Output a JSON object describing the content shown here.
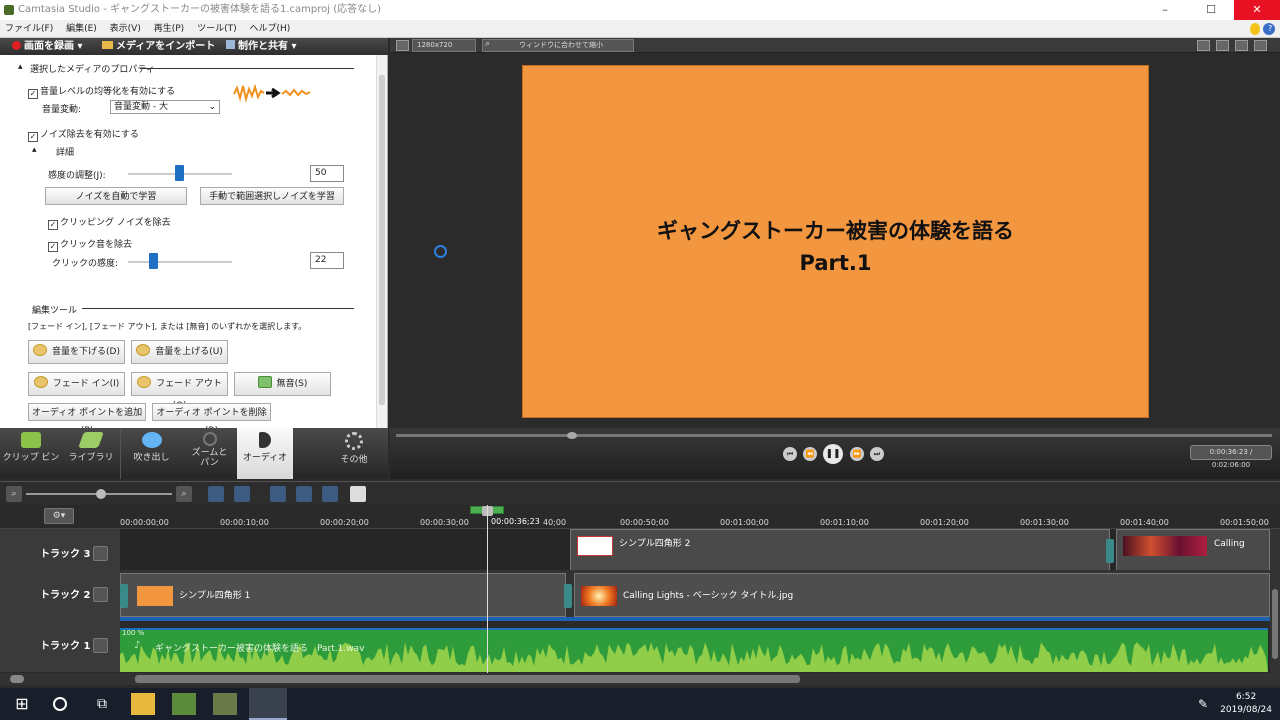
{
  "window": {
    "title": "Camtasia Studio - ギャングストーカーの被害体験を語る1.camproj (応答なし)",
    "min": "–",
    "max": "☐",
    "close": "✕"
  },
  "menu": [
    "ファイル(F)",
    "編集(E)",
    "表示(V)",
    "再生(P)",
    "ツール(T)",
    "ヘルプ(H)"
  ],
  "toolbar": {
    "record": "画面を録画 ▾",
    "import": "メディアをインポート",
    "produce": "制作と共有 ▾"
  },
  "props": {
    "section_title": "選択したメディアのプロパティ",
    "volume_leveling": "音量レベルの均等化を有効にする",
    "volume_change_label": "音量変動:",
    "volume_change_value": "音量変動 - 大",
    "noise_removal": "ノイズ除去を有効にする",
    "details": "詳細",
    "sensitivity_label": "感度の調整(J):",
    "sensitivity_value": "50",
    "auto_learn": "ノイズを自動で学習",
    "manual_learn": "手動で範囲選択しノイズを学習",
    "remove_clipping": "クリッピング ノイズを除去",
    "remove_clicks": "クリック音を除去",
    "click_sensitivity_label": "クリックの感度:",
    "click_sensitivity_value": "22",
    "edit_tools": "編集ツール",
    "edit_desc": "[フェード イン], [フェード アウト], または [無音] のいずれかを選択します。",
    "vol_down": "音量を下げる(D)",
    "vol_up": "音量を上げる(U)",
    "fade_in": "フェード イン(I)",
    "fade_out": "フェード アウト(O)",
    "silence": "無音(S)",
    "add_point": "オーディオ ポイントを追加(P)",
    "del_point": "オーディオ ポイントを削除(R)"
  },
  "tabs": [
    {
      "label": "クリップ ビン"
    },
    {
      "label": "ライブラリ"
    },
    {
      "label": "吹き出し"
    },
    {
      "label": "ズームと\nパン"
    },
    {
      "label": "オーディオ"
    },
    {
      "label": "その他"
    }
  ],
  "preview": {
    "size_box": "1280x720",
    "fit_box": "ウィンドウに合わせて縮小",
    "canvas_line1": "ギャングストーカー被害の体験を語る",
    "canvas_line2": "Part.1",
    "canvas_color": "#f39640",
    "time": "0:00:36:23 / 0:02:06:00"
  },
  "ruler": {
    "labels": [
      "00:00:00;00",
      "00:00:10;00",
      "00:00:20;00",
      "00:00:30;00",
      "40;00",
      "00:00:50;00",
      "00:01:00;00",
      "00:01:10;00",
      "00:01:20;00",
      "00:01:30;00",
      "00:01:40;00",
      "00:01:50;00"
    ],
    "playhead": "00:00:36;23"
  },
  "tracks": [
    {
      "name": "トラック 3",
      "clip1": "シンプル四角形 2",
      "clip2": "Calling Lights"
    },
    {
      "name": "トラック 2",
      "clip1": "シンプル四角形 1",
      "clip2": "Calling Lights - ベーシック タイトル.jpg"
    },
    {
      "name": "トラック 1",
      "clip1": "ギャングストーカー被害の体験を語る　Part.1.wav",
      "level": "100 %"
    }
  ],
  "taskbar": {
    "time": "6:52",
    "date": "2019/08/24"
  }
}
